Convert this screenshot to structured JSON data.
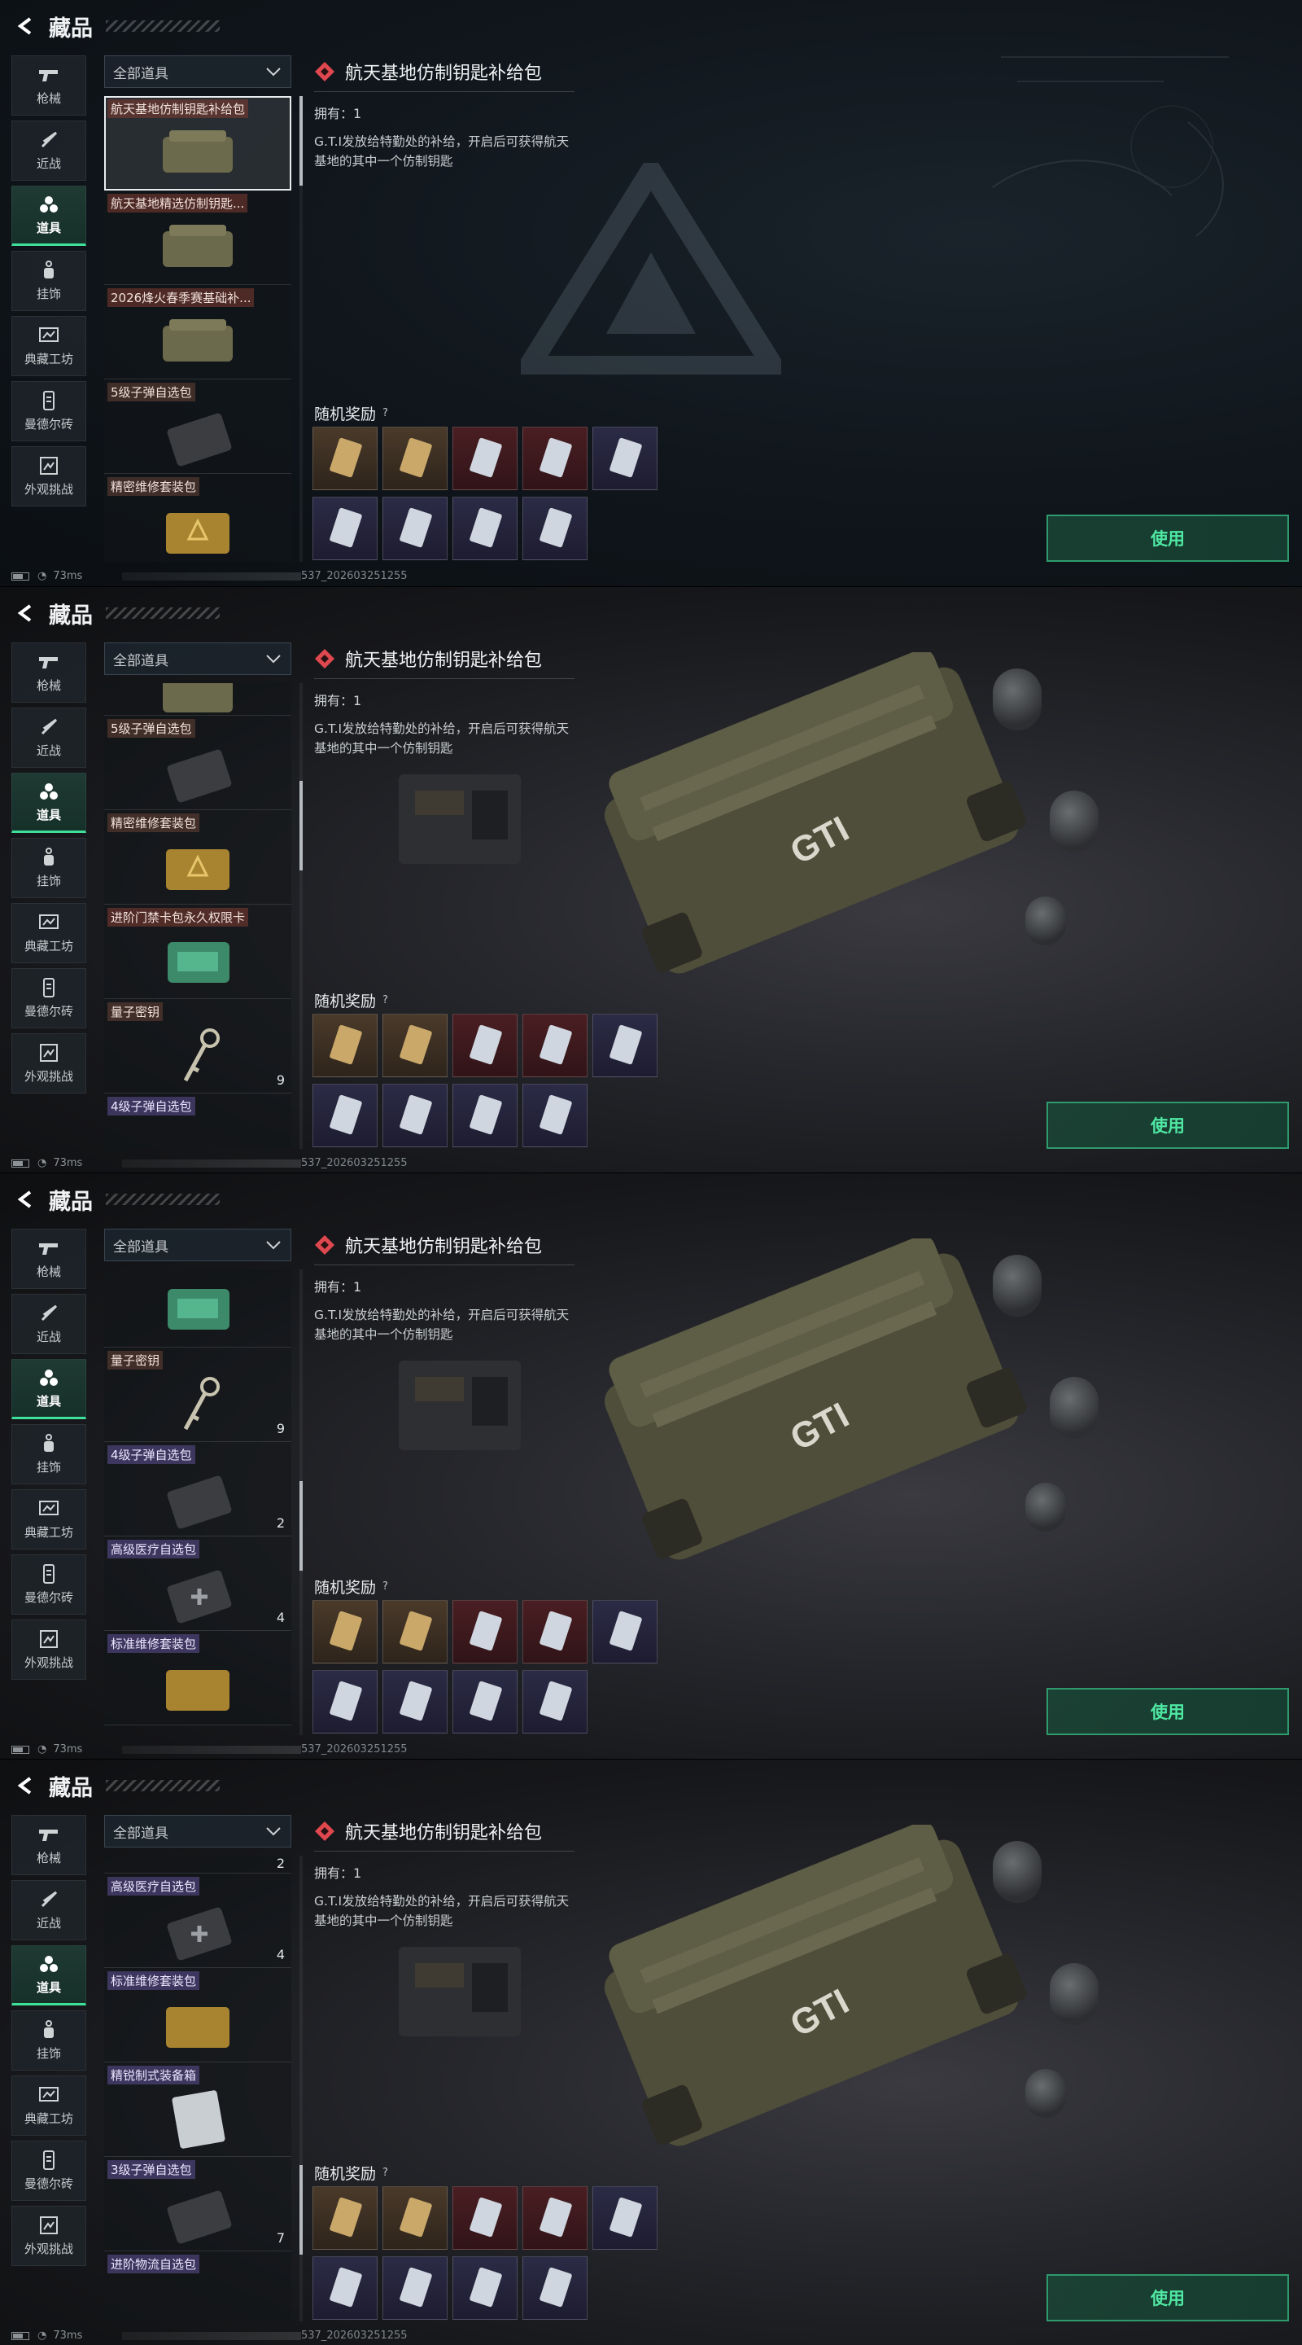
{
  "header": {
    "title": "藏品"
  },
  "nav": [
    {
      "label": "枪械",
      "icon": "gun-icon"
    },
    {
      "label": "近战",
      "icon": "knife-icon"
    },
    {
      "label": "道具",
      "icon": "items-icon",
      "active": true
    },
    {
      "label": "挂饰",
      "icon": "charm-icon"
    },
    {
      "label": "典藏工坊",
      "icon": "workshop-icon"
    },
    {
      "label": "曼德尔砖",
      "icon": "brick-icon"
    },
    {
      "label": "外观挑战",
      "icon": "challenge-icon"
    }
  ],
  "filter": {
    "label": "全部道具"
  },
  "item_names": {
    "key_pack": "航天基地仿制钥匙补给包",
    "key_pack_elite": "航天基地精选仿制钥匙...",
    "season_pack": "2026烽火春季赛基础补...",
    "ammo5": "5级子弹自选包",
    "repair_precise": "精密维修套装包",
    "access_card": "进阶门禁卡包永久权限卡",
    "quantum_key": "量子密钥",
    "ammo4": "4级子弹自选包",
    "med_high": "高级医疗自选包",
    "repair_std": "标准维修套装包",
    "equip_elite": "精锐制式装备箱",
    "ammo3": "3级子弹自选包",
    "logistics": "进阶物流自选包"
  },
  "counts": {
    "quantum_key": "9",
    "ammo4": "2",
    "med_high": "4",
    "ammo3": "7"
  },
  "detail": {
    "title": "航天基地仿制钥匙补给包",
    "owned": "拥有：1",
    "description": "G.T.I发放给特勤处的补给，开启后可获得航天基地的其中一个仿制钥匙"
  },
  "rewards": {
    "label": "随机奖励",
    "help": "?",
    "tiers": [
      "brown",
      "brown",
      "red",
      "red",
      "purple",
      "purple",
      "purple",
      "purple",
      "purple"
    ]
  },
  "use_button": "使用",
  "status": {
    "ping": "73ms",
    "version": "537_202603251255"
  },
  "colors": {
    "accent": "#3ee09a",
    "use_text": "#4fe8a3",
    "rarity": "#e0484f"
  }
}
